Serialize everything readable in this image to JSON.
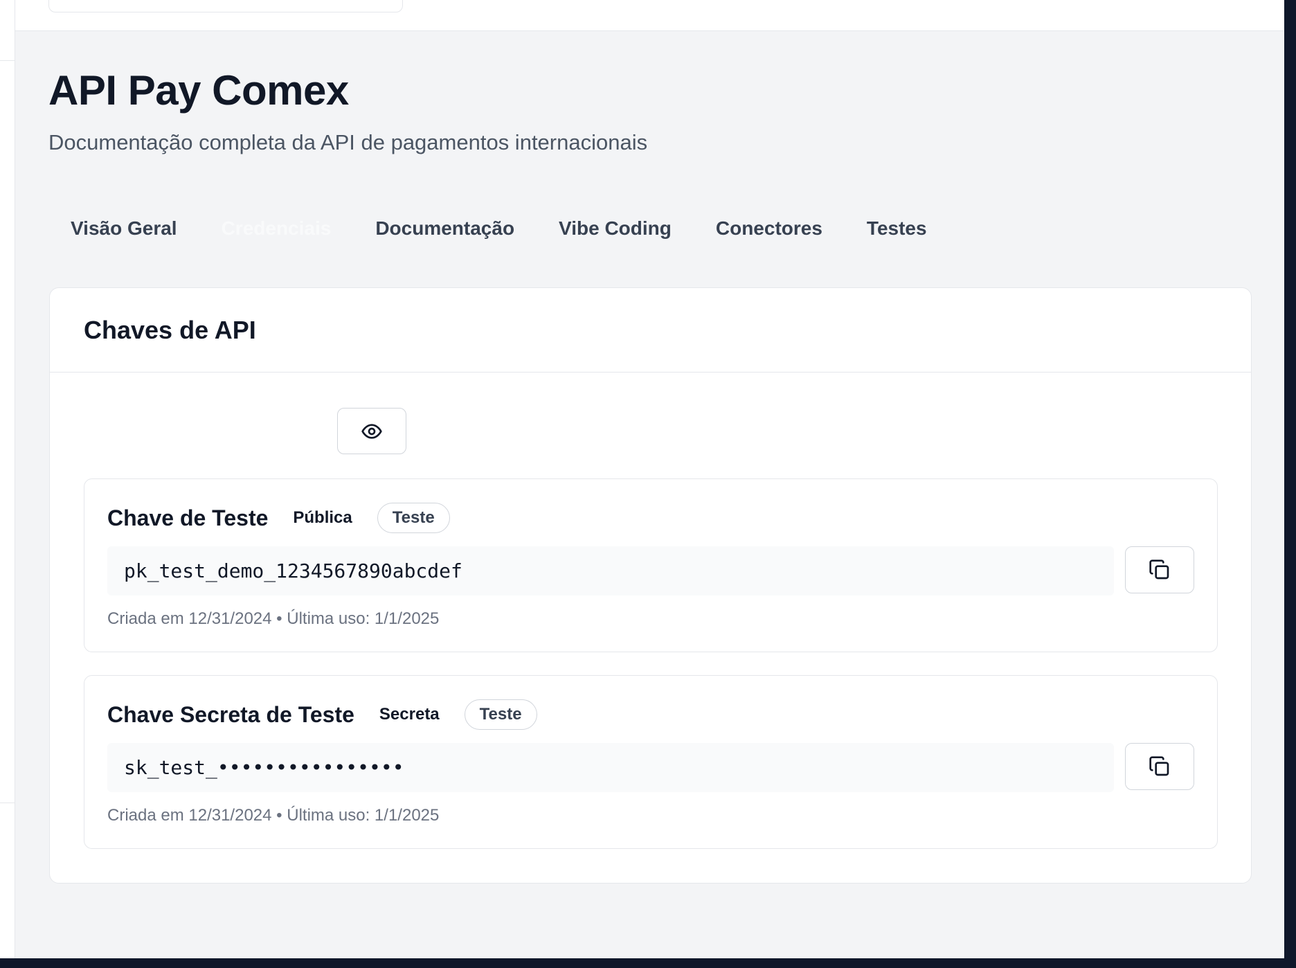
{
  "header": {
    "title": "API Pay Comex",
    "subtitle": "Documentação completa da API de pagamentos internacionais"
  },
  "tabs": [
    {
      "label": "Visão Geral",
      "active": false
    },
    {
      "label": "Credenciais",
      "active": true
    },
    {
      "label": "Documentação",
      "active": false
    },
    {
      "label": "Vibe Coding",
      "active": false
    },
    {
      "label": "Conectores",
      "active": false
    },
    {
      "label": "Testes",
      "active": false
    }
  ],
  "api_keys": {
    "title": "Chaves de API",
    "toggle_icon": "eye-icon",
    "copy_icon": "copy-icon",
    "keys": [
      {
        "name": "Chave de Teste",
        "type": "Pública",
        "env": "Teste",
        "value": "pk_test_demo_1234567890abcdef",
        "meta": "Criada em 12/31/2024 • Última uso: 1/1/2025"
      },
      {
        "name": "Chave Secreta de Teste",
        "type": "Secreta",
        "env": "Teste",
        "value": "sk_test_••••••••••••••••",
        "meta": "Criada em 12/31/2024 • Última uso: 1/1/2025"
      }
    ]
  },
  "colors": {
    "background": "#f3f4f6",
    "card": "#ffffff",
    "text_primary": "#111827",
    "text_muted": "#6b7280",
    "active_tab_text": "#f9fafb"
  }
}
